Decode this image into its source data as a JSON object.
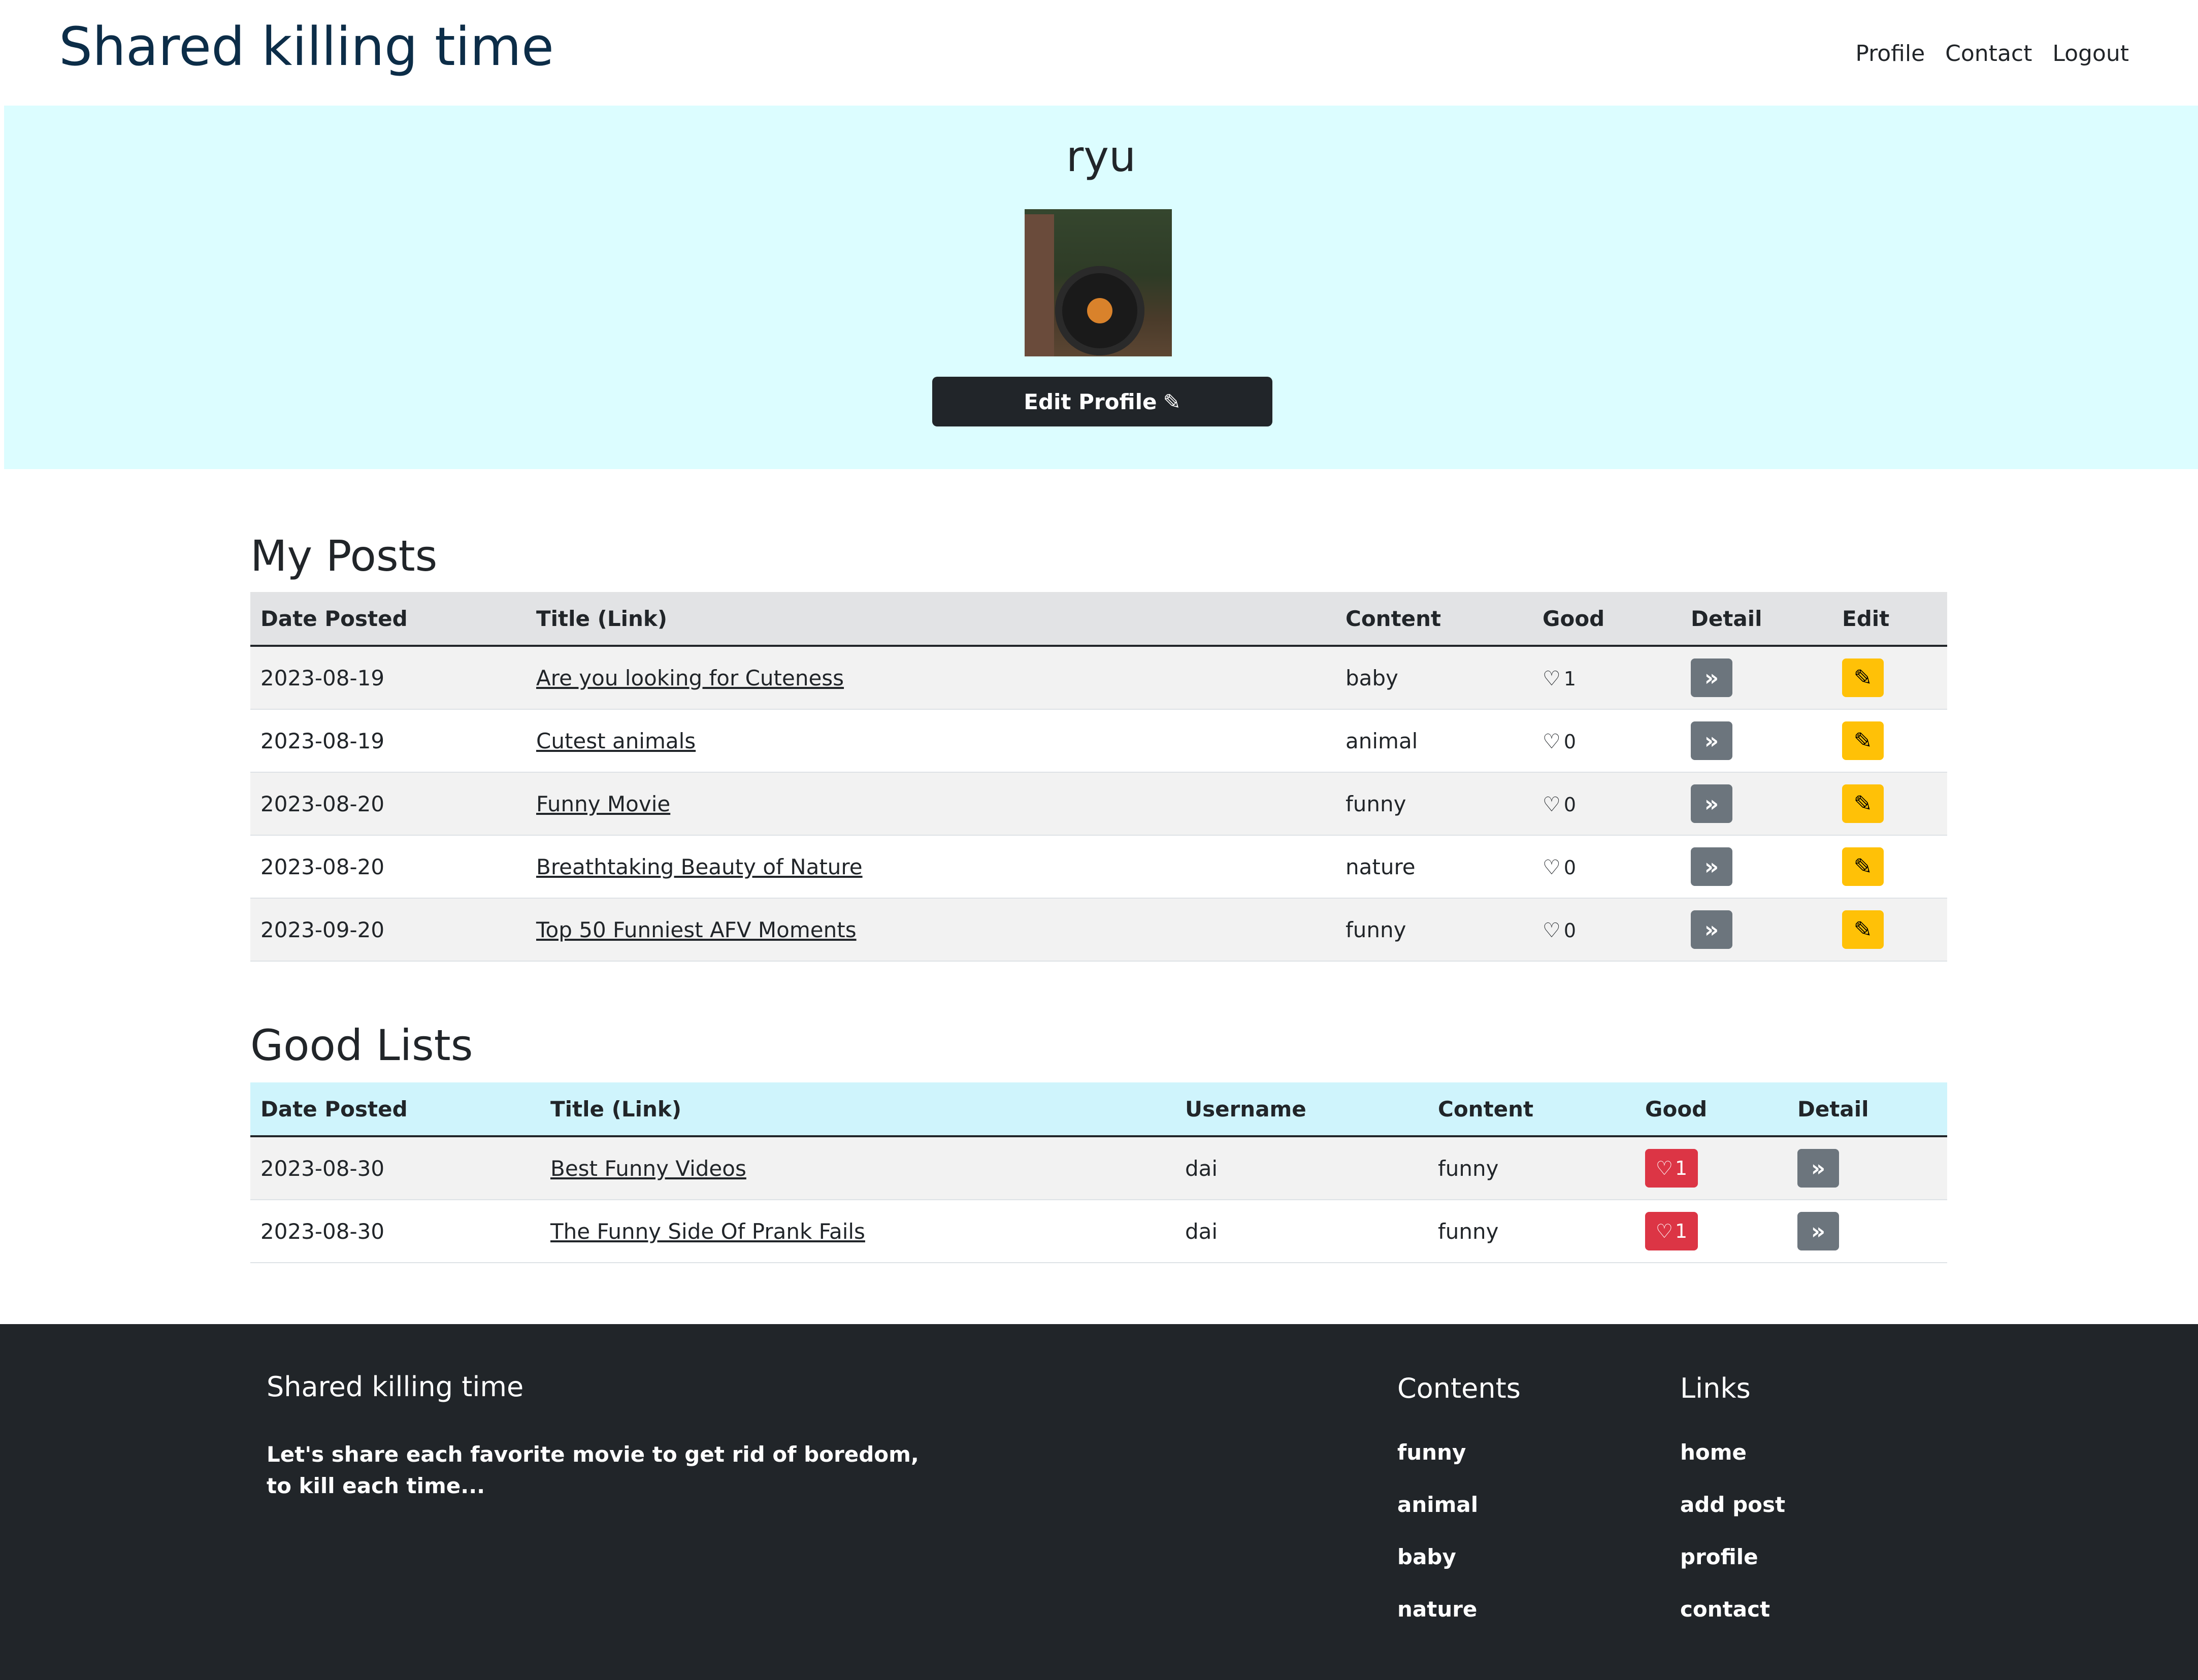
{
  "header": {
    "brand": "Shared killing time",
    "nav": [
      {
        "label": "Profile"
      },
      {
        "label": "Contact"
      },
      {
        "label": "Logout"
      }
    ]
  },
  "profile": {
    "username": "ryu",
    "edit_button_label": "Edit Profile",
    "edit_icon": "pencil-icon"
  },
  "my_posts": {
    "title": "My Posts",
    "columns": [
      "Date Posted",
      "Title (Link)",
      "Content",
      "Good",
      "Detail",
      "Edit"
    ],
    "rows": [
      {
        "date": "2023-08-19",
        "title": "Are you looking for Cuteness",
        "content": "baby",
        "good": "1"
      },
      {
        "date": "2023-08-19",
        "title": "Cutest animals",
        "content": "animal",
        "good": "0"
      },
      {
        "date": "2023-08-20",
        "title": "Funny Movie",
        "content": "funny",
        "good": "0"
      },
      {
        "date": "2023-08-20",
        "title": "Breathtaking Beauty of Nature",
        "content": "nature",
        "good": "0"
      },
      {
        "date": "2023-09-20",
        "title": "Top 50 Funniest AFV Moments",
        "content": "funny",
        "good": "0"
      }
    ]
  },
  "good_lists": {
    "title": "Good Lists",
    "columns": [
      "Date Posted",
      "Title (Link)",
      "Username",
      "Content",
      "Good",
      "Detail"
    ],
    "rows": [
      {
        "date": "2023-08-30",
        "title": "Best Funny Videos",
        "username": "dai",
        "content": "funny",
        "good": "1"
      },
      {
        "date": "2023-08-30",
        "title": "The Funny Side Of Prank Fails",
        "username": "dai",
        "content": "funny",
        "good": "1"
      }
    ]
  },
  "icons": {
    "heart": "♡",
    "detail": "»",
    "edit": "✎"
  },
  "footer": {
    "brand": "Shared killing time",
    "description": "Let's share each favorite movie to get rid of boredom, to kill each time...",
    "contents_heading": "Contents",
    "contents": [
      "funny",
      "animal",
      "baby",
      "nature"
    ],
    "links_heading": "Links",
    "links": [
      "home",
      "add post",
      "profile",
      "contact"
    ]
  },
  "colors": {
    "banner_bg": "#dcfdff",
    "brand_text": "#0c2d48",
    "dark": "#212529",
    "detail_button": "#6c757d",
    "edit_button": "#ffc107",
    "good_button": "#dc3545",
    "good_lists_header": "#cff4fc"
  }
}
